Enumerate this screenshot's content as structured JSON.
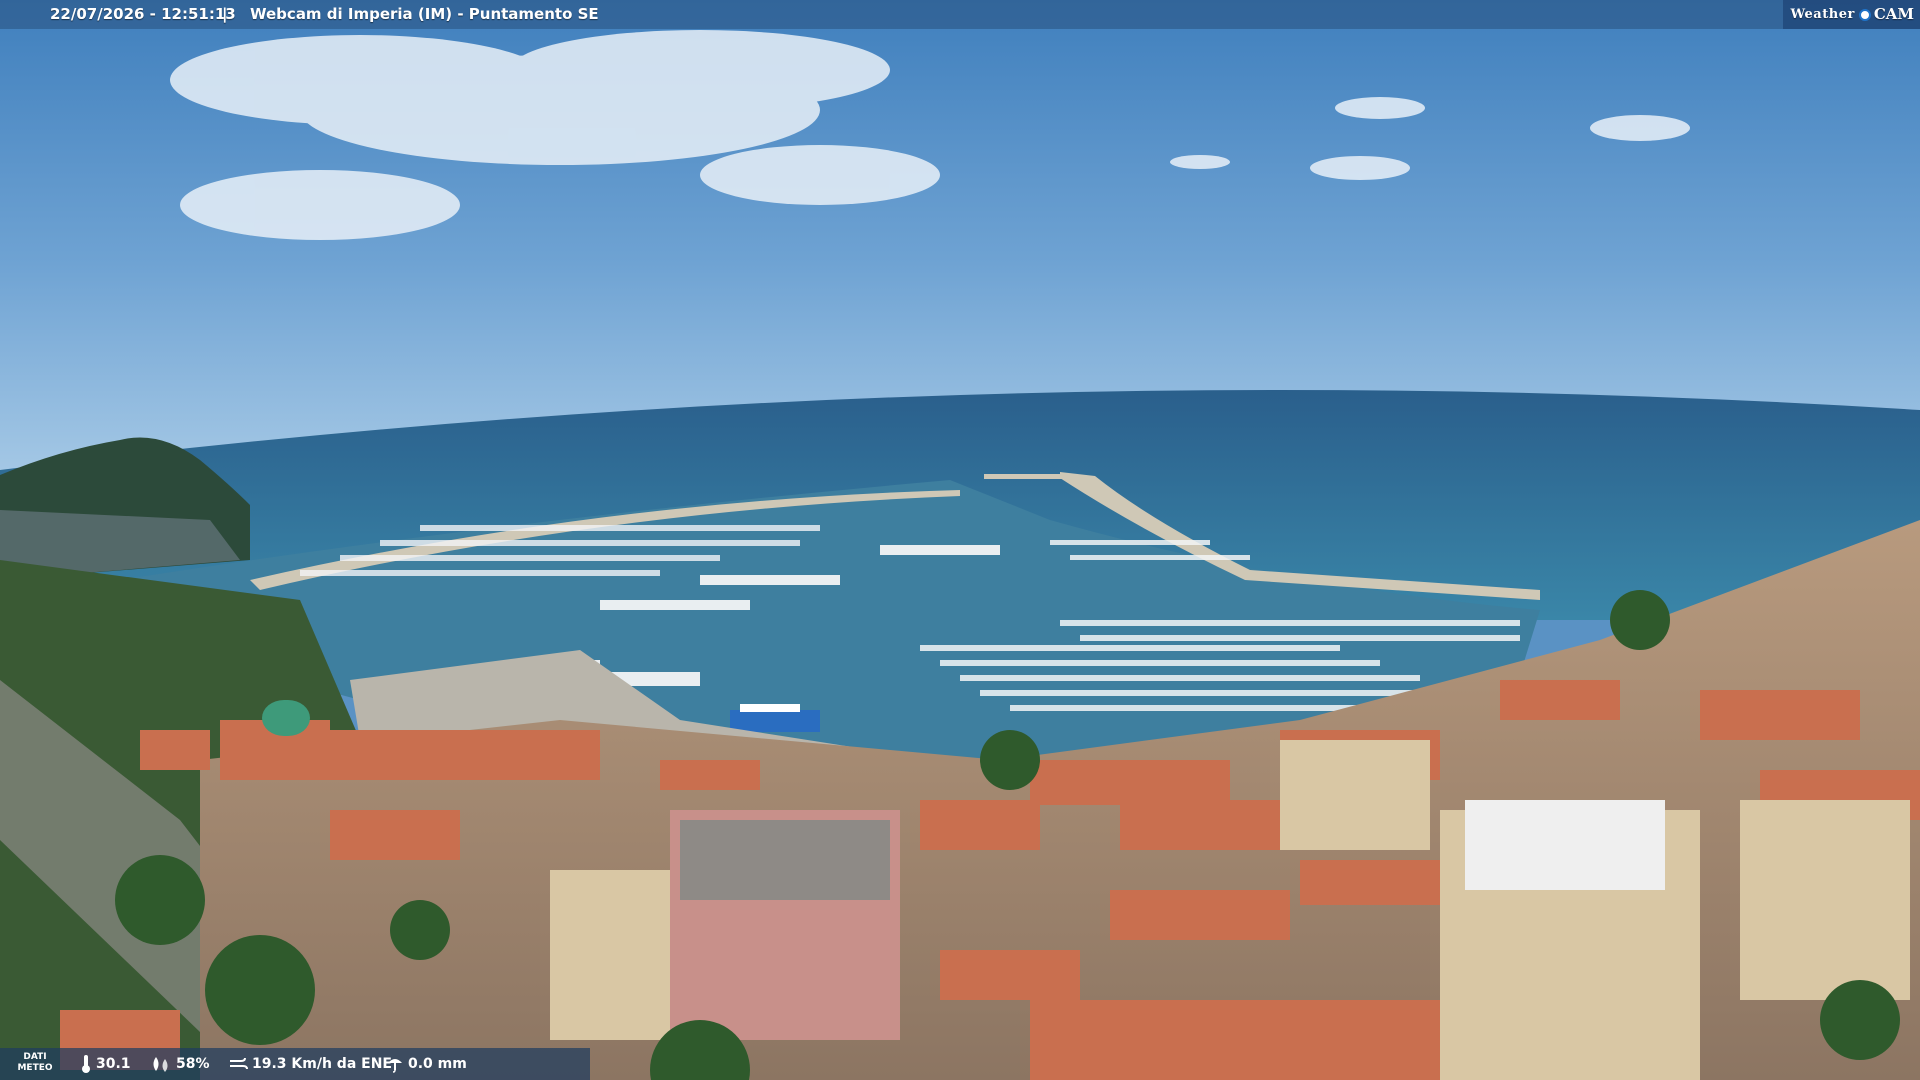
{
  "overlay": {
    "datetime": "22/07/2026 - 12:51:13",
    "separator": "|",
    "title": "Webcam di Imperia (IM) - Puntamento SE",
    "brand": {
      "word": "Weather",
      "suffix": "CAM"
    }
  },
  "weather": {
    "label_line1": "DATI",
    "label_line2": "METEO",
    "temperature": "30.1",
    "humidity": "58%",
    "wind": "19.3 Km/h da ENE",
    "rain": "0.0 mm"
  },
  "colors": {
    "sky_top": "#3f7fbd",
    "sky_horizon": "#a6c9e6",
    "sea": "#2f6f9a",
    "harbour_water": "#3e7f9f",
    "roof": "#c96f4f"
  },
  "icons": {
    "temperature": "thermometer-icon",
    "humidity": "humidity-icon",
    "wind": "wind-icon",
    "rain": "rain-icon",
    "brand": "camera-lens-icon"
  }
}
